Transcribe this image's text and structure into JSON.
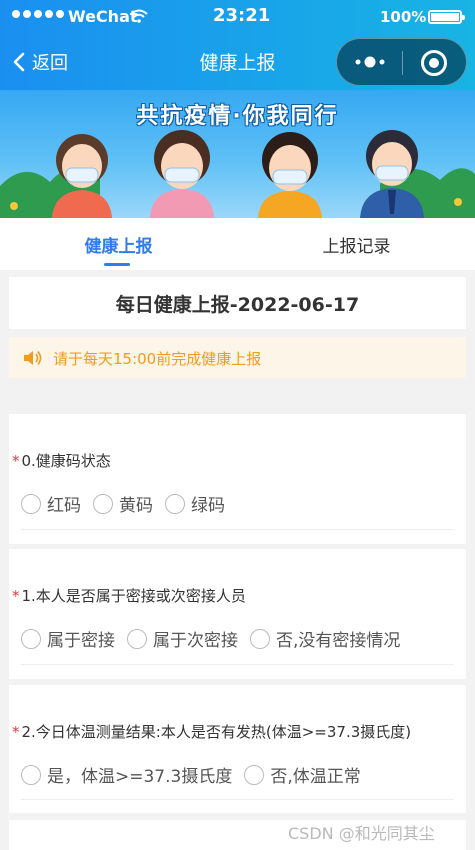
{
  "status_bar": {
    "carrier": "WeChat",
    "time": "23:21",
    "battery": "100%"
  },
  "nav": {
    "back_label": "返回",
    "title": "健康上报"
  },
  "banner": {
    "title": "共抗疫情·你我同行"
  },
  "tabs": [
    {
      "label": "健康上报",
      "active": true
    },
    {
      "label": "上报记录",
      "active": false
    }
  ],
  "form": {
    "title": "每日健康上报-2022-06-17",
    "notice": "请于每天15:00前完成健康上报",
    "required_mark": "*",
    "questions": [
      {
        "label": "0.健康码状态",
        "options": [
          "红码",
          "黄码",
          "绿码"
        ]
      },
      {
        "label": "1.本人是否属于密接或次密接人员",
        "options": [
          "属于密接",
          "属于次密接",
          "否,没有密接情况"
        ]
      },
      {
        "label": "2.今日体温测量结果:本人是否有发热(体温>=37.3摄氏度)",
        "options": [
          "是，体温>=37.3摄氏度",
          "否,体温正常"
        ]
      }
    ]
  },
  "watermark": "CSDN @和光同其尘",
  "colors": {
    "accent": "#2f7cec",
    "notice_text": "#f39b1a",
    "required": "#e5393c"
  }
}
